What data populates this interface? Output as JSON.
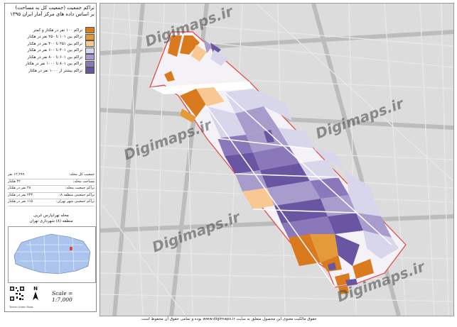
{
  "title": {
    "line1": "تراکم جمعیت (جمعیت کل به مساحت)",
    "line2": "بر اساس داده های مرکز آمار ایران ۱۳۹۵"
  },
  "legend": [
    {
      "label": "تراکم ۱۰۰ نفر در هکتار و کمتر",
      "color": "#d97a1f"
    },
    {
      "label": "تراکم بین ۱۰۱ تا ۲۵۰ نفر در هکتار",
      "color": "#e59a3a"
    },
    {
      "label": "تراکم بین ۲۵۱ تا ۴۰۰ نفر در هکتار",
      "color": "#f7c892"
    },
    {
      "label": "تراکم بین ۴۰۱ تا ۶۰۰ نفر در هکتار",
      "color": "#d8d6ea"
    },
    {
      "label": "تراکم بین ۶۰۱ تا ۸۰۰ نفر در هکتار",
      "color": "#a79ccc"
    },
    {
      "label": "تراکم بین ۸۰۱ تا ۱۰۰۰ نفر در هکتار",
      "color": "#8a78ba"
    },
    {
      "label": "تراکم بیشتر از ۱۰۰۰ نفر در هکتار",
      "color": "#6a55a2"
    }
  ],
  "stats": [
    {
      "label": "جمعیت کل محله:",
      "value": "۱۲,۲۹۹ نفر"
    },
    {
      "label": "مساحت محله:",
      "value": "۴۲ هکتار"
    },
    {
      "label": "تراکم جمعیت محله:",
      "value": "۲۸ نفر در هکتار"
    },
    {
      "label": "تراکم جمعیتی منطقه ۸:",
      "value": "۲۴۳ نفر در هکتار"
    },
    {
      "label": "تراکم جمعیتی شهر تهران:",
      "value": "۱۱۵ نفر در هکتار"
    }
  ],
  "inset": {
    "line1": "محله تهرانپارس غربی",
    "line2": "منطقه (۸) شهرداری تهران"
  },
  "scale": "Scale = 1:7,000",
  "north": "N",
  "small_note": "Tehran Urban Maps",
  "watermark": "Digimaps.ir",
  "footer": "حقوق مالکیت معنوی این محصول متعلق به سایت www.digimaps.ir بوده و تمامی حقوق آن محفوظ است.",
  "colors": {
    "road_dark": "#b8b8b8",
    "background": "#dedede",
    "boundary": "#e0453f"
  }
}
